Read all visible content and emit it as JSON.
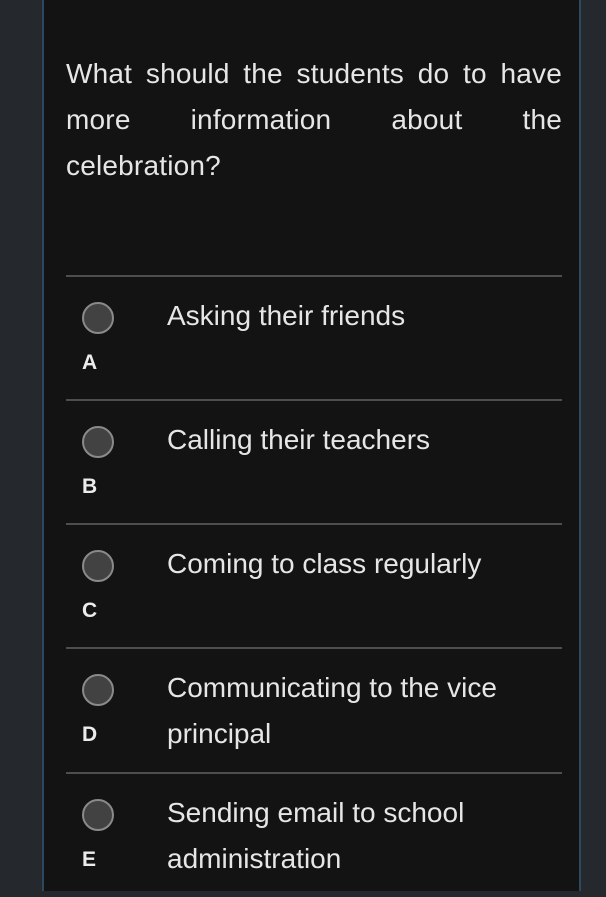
{
  "question": {
    "text": "What should the students do to have more information about the celebration?"
  },
  "options": [
    {
      "letter": "A",
      "text": "Asking their friends",
      "selected": false
    },
    {
      "letter": "B",
      "text": "Calling their teachers",
      "selected": false
    },
    {
      "letter": "C",
      "text": "Coming to class regularly",
      "selected": false
    },
    {
      "letter": "D",
      "text": "Communicating to the vice principal",
      "selected": false
    },
    {
      "letter": "E",
      "text": "Sending email to school administration",
      "selected": false
    }
  ],
  "colors": {
    "page_background": "#25282d",
    "card_background": "#131313",
    "card_border": "#2b4a60",
    "text": "#e6e6e6",
    "divider": "#4e4e4e",
    "radio_fill": "#424242",
    "radio_border": "#8a8a8a"
  }
}
